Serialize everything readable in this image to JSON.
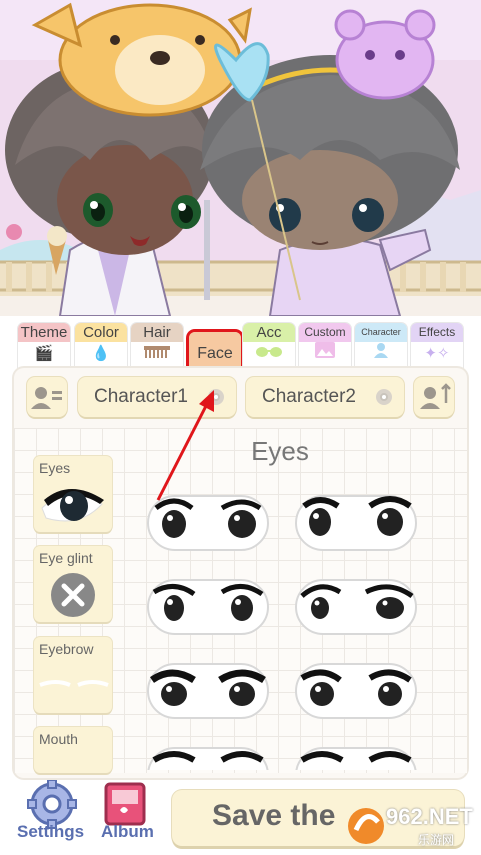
{
  "tabs": [
    {
      "label": "Theme",
      "color": "#f4c4c6",
      "icon": "clapper-icon"
    },
    {
      "label": "Color",
      "color": "#fbe2a0",
      "icon": "drop-icon"
    },
    {
      "label": "Hair",
      "color": "#e6d3c3",
      "icon": "comb-icon"
    },
    {
      "label": "Face",
      "color": "#f6c9a1",
      "icon": "face-icon"
    },
    {
      "label": "Acc",
      "color": "#d9f0a8",
      "icon": "glasses-icon"
    },
    {
      "label": "Custom",
      "color": "#f1c8ee",
      "icon": "image-icon"
    },
    {
      "label": "Character",
      "color": "#cde9f7",
      "icon": "person-icon"
    },
    {
      "label": "Effects",
      "color": "#e2d4f5",
      "icon": "sparkle-icon"
    }
  ],
  "character_selector": {
    "char1": "Character1",
    "char2": "Character2",
    "selected": "Character1"
  },
  "section_title": "Eyes",
  "categories": [
    {
      "label": "Eyes"
    },
    {
      "label": "Eye glint"
    },
    {
      "label": "Eyebrow"
    },
    {
      "label": "Mouth"
    }
  ],
  "bottom": {
    "settings_label": "Settings",
    "album_label": "Album",
    "save_label": "Save the"
  },
  "watermark": {
    "text": "962.NET",
    "sub": "乐游网"
  },
  "highlight_color": "#e0161b",
  "arrow_color": "#e0161b"
}
